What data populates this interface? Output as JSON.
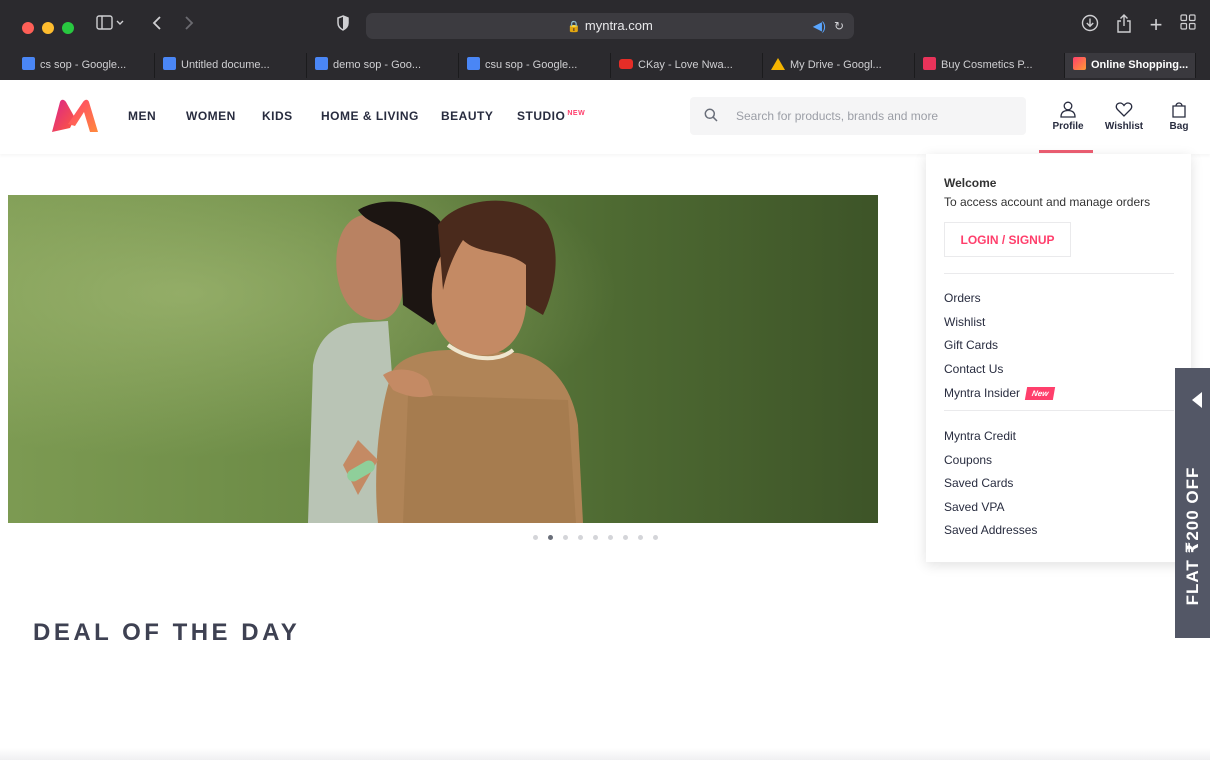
{
  "browser": {
    "url": "myntra.com",
    "tabs": [
      {
        "label": "cs sop - Google...",
        "icon": "docs-icon"
      },
      {
        "label": "Untitled docume...",
        "icon": "docs-icon"
      },
      {
        "label": "demo sop - Goo...",
        "icon": "docs-icon"
      },
      {
        "label": "csu sop - Google...",
        "icon": "docs-icon"
      },
      {
        "label": "CKay - Love Nwa...",
        "icon": "youtube-icon"
      },
      {
        "label": "My Drive - Googl...",
        "icon": "drive-icon"
      },
      {
        "label": "Buy Cosmetics P...",
        "icon": "nykaa-icon"
      },
      {
        "label": "Online Shopping...",
        "icon": "myntra-icon"
      }
    ]
  },
  "header": {
    "nav": [
      "MEN",
      "WOMEN",
      "KIDS",
      "HOME & LIVING",
      "BEAUTY",
      "STUDIO"
    ],
    "studio_badge": "NEW",
    "search_placeholder": "Search for products, brands and more",
    "actions": {
      "profile": "Profile",
      "wishlist": "Wishlist",
      "bag": "Bag"
    }
  },
  "hero": {
    "slide_count": 10,
    "active_slide": 2
  },
  "deal_title": "DEAL OF THE DAY",
  "profile_menu": {
    "welcome": "Welcome",
    "subtitle": "To access account and manage orders",
    "login_label": "LOGIN / SIGNUP",
    "group1": [
      "Orders",
      "Wishlist",
      "Gift Cards",
      "Contact Us",
      "Myntra Insider"
    ],
    "insider_badge": "New",
    "group2": [
      "Myntra Credit",
      "Coupons",
      "Saved Cards",
      "Saved VPA",
      "Saved Addresses"
    ]
  },
  "side_offer": "FLAT ₹200 OFF",
  "colors": {
    "accent": "#ff3f6c",
    "chrome": "#2b2a2e",
    "text": "#282c3f"
  }
}
